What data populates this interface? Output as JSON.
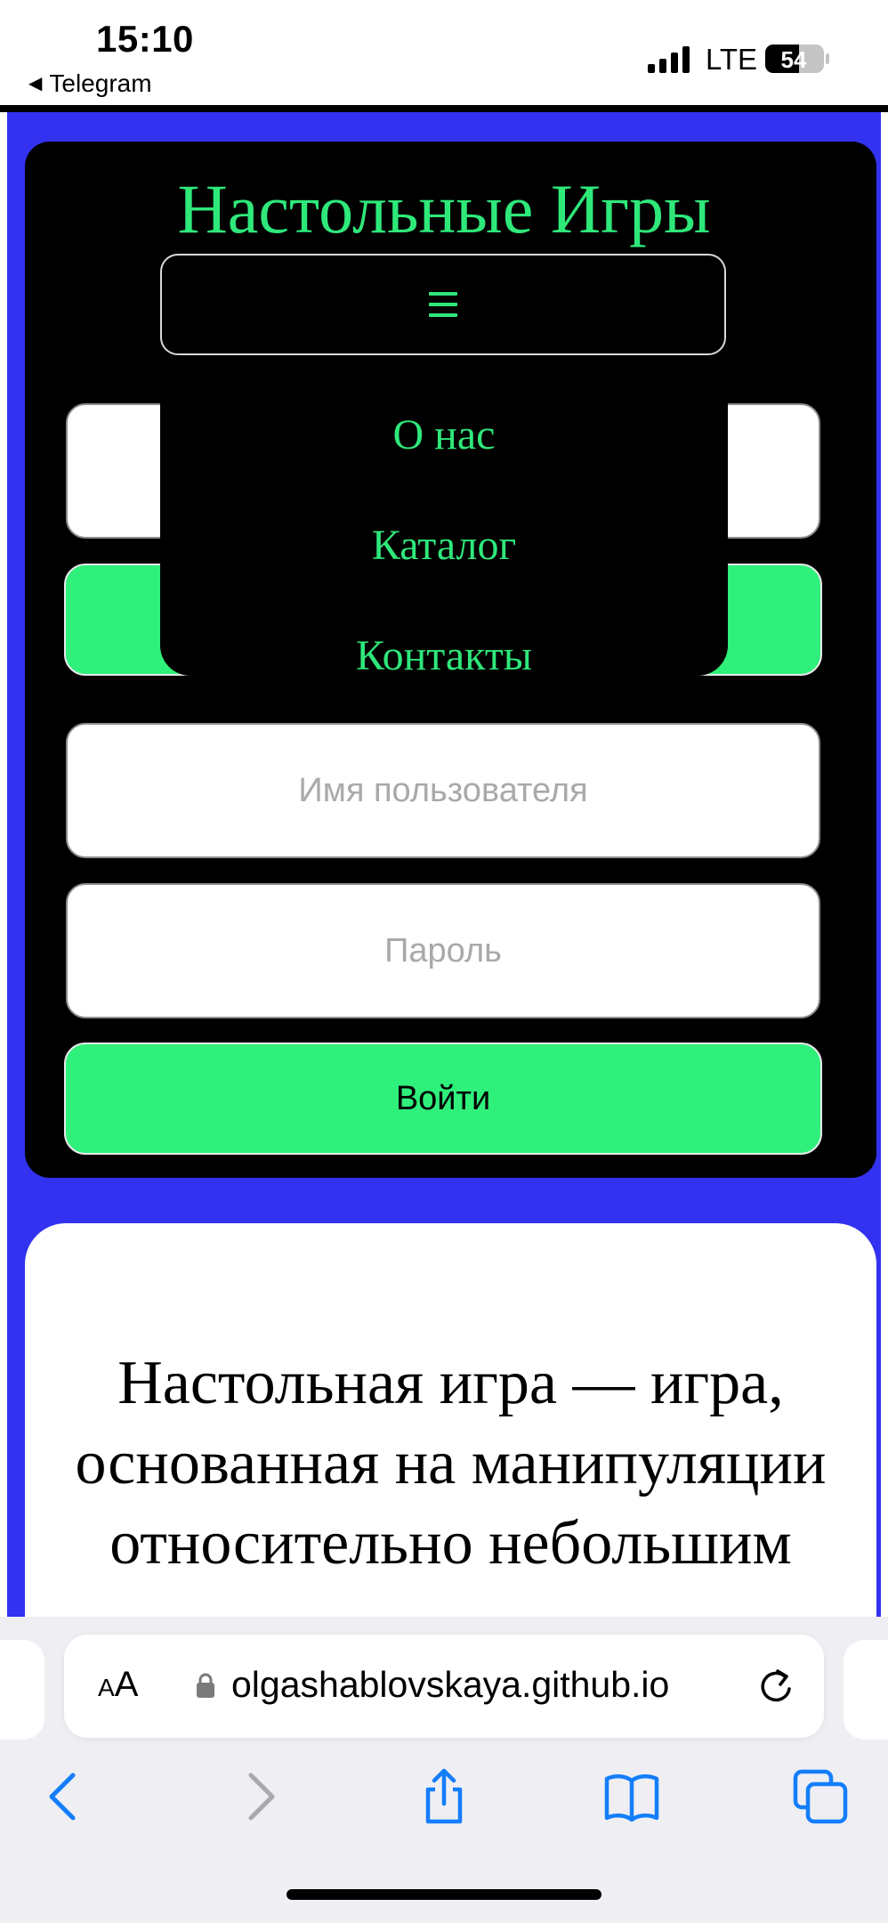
{
  "status_bar": {
    "time": "15:10",
    "back_app": "Telegram",
    "network": "LTE",
    "battery": "54"
  },
  "site": {
    "title": "Настольные Игры",
    "menu_icon": "hamburger-menu-icon",
    "nav_items": [
      "О нас",
      "Каталог",
      "Контакты"
    ]
  },
  "login_form": {
    "username_placeholder": "Имя пользователя",
    "password_placeholder": "Пароль",
    "submit_label": "Войти"
  },
  "article": {
    "text": "Настольная игра — игра, основанная на манипуляции относительно небольшим"
  },
  "browser": {
    "text_size_label_small": "A",
    "text_size_label_large": "A",
    "url": "olgashablovskaya.github.io",
    "toolbar": [
      "back-icon",
      "forward-icon",
      "share-icon",
      "bookmarks-icon",
      "tabs-icon"
    ]
  },
  "colors": {
    "accent_green": "#2ee87a",
    "page_blue": "#3232f0",
    "panel_black": "#000000",
    "ios_blue": "#147efb"
  }
}
